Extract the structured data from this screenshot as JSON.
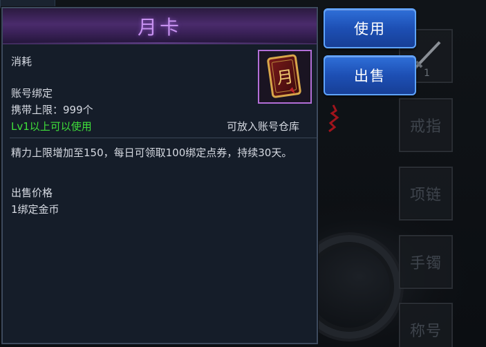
{
  "tooltip": {
    "title": "月卡",
    "category": "消耗",
    "binding": "账号绑定",
    "stack_limit": "携带上限：999个",
    "level_requirement": "Lv1以上可以使用",
    "warehouse_note": "可放入账号仓库",
    "description": "精力上限增加至150，每日可领取100绑定点券，持续30天。",
    "sell_price_label": "出售价格",
    "sell_price_value": "1绑定金币",
    "icon_glyph": "月",
    "title_color": "#c791f0",
    "requirement_color": "#3fe03a"
  },
  "actions": {
    "use_label": "使用",
    "sell_label": "出售"
  },
  "equipment_slots": {
    "weapon_level": "1",
    "ring_label": "戒指",
    "necklace_label": "项链",
    "bracelet_label": "手镯",
    "title_label": "称号"
  }
}
